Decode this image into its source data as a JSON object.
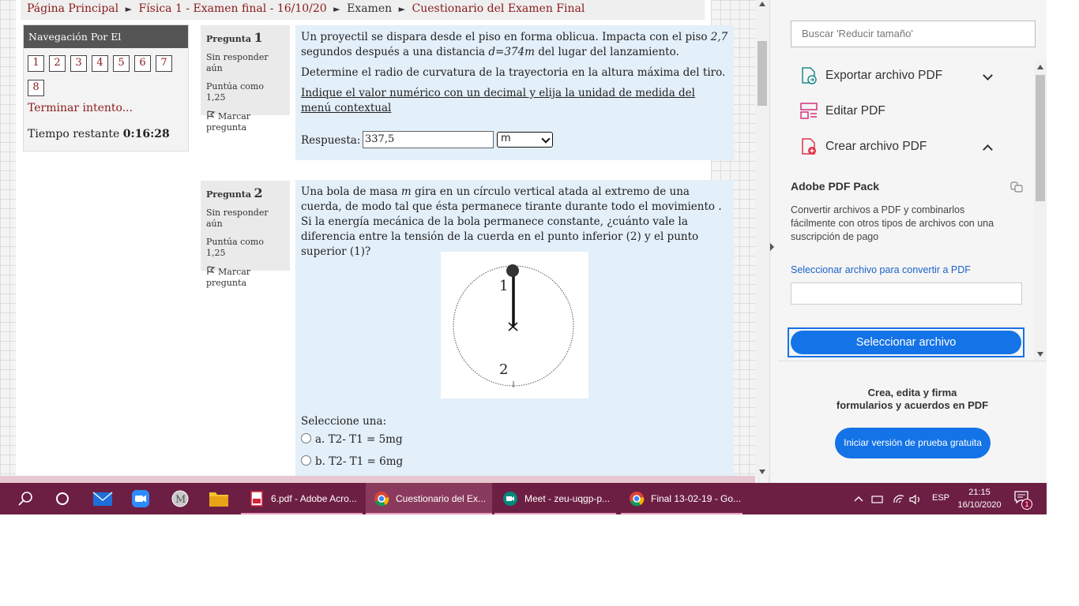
{
  "breadcrumb": {
    "home": "Página Principal",
    "course": "Física 1 - Examen final - 16/10/20",
    "section": "Examen",
    "quiz": "Cuestionario del Examen Final",
    "separator": "►"
  },
  "nav": {
    "title": "Navegación Por El Cuestionario",
    "question_numbers": [
      "1",
      "2",
      "3",
      "4",
      "5",
      "6",
      "7",
      "8"
    ],
    "finish_link": "Terminar intento...",
    "time_label": "Tiempo restante",
    "time_value": "0:16:28"
  },
  "questions": [
    {
      "label": "Pregunta",
      "number": "1",
      "status": "Sin responder aún",
      "score": "Puntúa como 1,25",
      "flag_label": "Marcar pregunta",
      "text_a1": "Un proyectil se dispara desde el piso en forma oblicua. Impacta con el piso ",
      "text_a2": "2,7",
      "text_a3": " segundos después a una distancia ",
      "text_a4": "d=374m",
      "text_a5": " del lugar del lanzamiento.",
      "text_b": "Determine el radio de curvatura de la trayectoria en la altura máxima del tiro.",
      "text_c": "Indique el valor numérico con un decimal y elija la unidad de medida del menú contextual",
      "answer_label": "Respuesta:",
      "answer_value": "337,5",
      "unit_selected": "m"
    },
    {
      "label": "Pregunta",
      "number": "2",
      "status": "Sin responder aún",
      "score": "Puntúa como 1,25",
      "flag_label": "Marcar pregunta",
      "text_a1": "Una bola de masa ",
      "text_a2": "m",
      "text_a3": " gira en un círculo vertical atada al extremo de una cuerda, de modo tal que ésta permanece tirante  durante todo el movimiento . Si la energía mecánica de la bola permanece constante, ¿cuánto vale la diferencia entre la tensión de la cuerda en el punto inferior (2) y el punto superior (1)?",
      "figure_label_top": "1",
      "figure_label_bottom": "2",
      "select_prompt": "Seleccione una:",
      "options": [
        "a. T2- T1 = 5mg",
        "b. T2- T1 = 6mg"
      ]
    }
  ],
  "acrobat": {
    "search_placeholder": "Buscar 'Reducir tamaño'",
    "tools": [
      "Exportar archivo PDF",
      "Editar PDF",
      "Crear archivo PDF"
    ],
    "pack_title": "Adobe PDF Pack",
    "pack_desc": "Convertir archivos a PDF y combinarlos fácilmente con otros tipos de archivos con una suscripción de pago",
    "pack_link": "Seleccionar archivo para convertir a PDF",
    "pack_button": "Seleccionar archivo",
    "promo_line1": "Crea, edita y firma",
    "promo_line2": "formularios y acuerdos en PDF",
    "promo_button": "Iniciar versión de prueba gratuita"
  },
  "taskbar": {
    "apps": [
      "6.pdf - Adobe Acro...",
      "Cuestionario del Ex...",
      "Meet - zeu-uqgp-p...",
      "Final 13-02-19 - Go..."
    ],
    "language": "ESP",
    "time": "21:15",
    "date": "16/10/2020",
    "notification_count": "1"
  },
  "colors": {
    "link": "#8b1a1a",
    "question_bg": "#e3eff9",
    "acrobat_blue": "#1473e6",
    "taskbar": "#6d1f43"
  }
}
